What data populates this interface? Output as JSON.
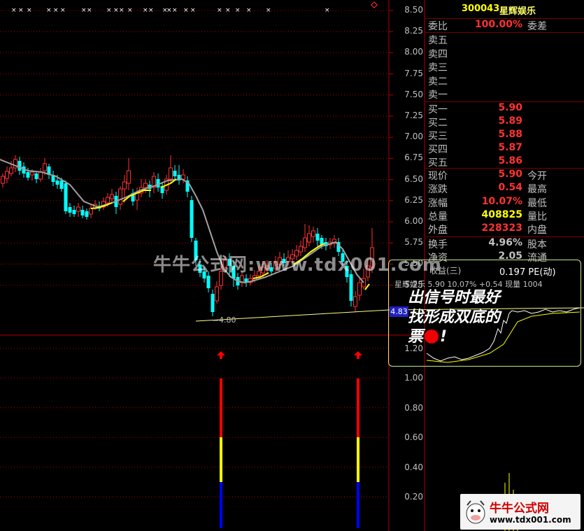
{
  "stock": {
    "code": "300043",
    "name": "星辉娱乐"
  },
  "order_book": {
    "ratio_label": "委比",
    "ratio_value": "100.00%",
    "diff_label": "委差",
    "sell": [
      {
        "label": "卖五",
        "price": ""
      },
      {
        "label": "卖四",
        "price": ""
      },
      {
        "label": "卖三",
        "price": ""
      },
      {
        "label": "卖二",
        "price": ""
      },
      {
        "label": "卖一",
        "price": ""
      }
    ],
    "buy": [
      {
        "label": "买一",
        "price": "5.90"
      },
      {
        "label": "买二",
        "price": "5.89"
      },
      {
        "label": "买三",
        "price": "5.88"
      },
      {
        "label": "买四",
        "price": "5.87"
      },
      {
        "label": "买五",
        "price": "5.86"
      }
    ]
  },
  "quote": {
    "rows": [
      {
        "label": "现价",
        "value": "5.90",
        "label2": "今开",
        "color": "#ff3232"
      },
      {
        "label": "涨跌",
        "value": "0.54",
        "label2": "最高",
        "color": "#ff3232"
      },
      {
        "label": "涨幅",
        "value": "10.07%",
        "label2": "最低",
        "color": "#ff3232"
      },
      {
        "label": "总量",
        "value": "408825",
        "label2": "量比",
        "color": "#ffff00"
      },
      {
        "label": "外盘",
        "value": "228323",
        "label2": "内盘",
        "color": "#ff3232"
      }
    ],
    "rows2": [
      {
        "label": "换手",
        "value": "4.96%",
        "label2": "股本",
        "color": "#c0c0c0"
      },
      {
        "label": "净资",
        "value": "2.05",
        "label2": "流通",
        "color": "#c0c0c0"
      }
    ]
  },
  "inset": {
    "pe_label": "收益(三)",
    "pe_value": "0.197 PE(动)",
    "mini_line": "星辉娱乐  5.90  10.07%  +0.54  现量 1004"
  },
  "price_axis": [
    "8.50",
    "8.25",
    "8.00",
    "7.75",
    "7.50",
    "7.25",
    "7.00",
    "6.75",
    "6.50",
    "6.25",
    "6.00",
    "5.75",
    "5.50",
    "5.25"
  ],
  "indicator_axis": [
    "1.20",
    "1.00",
    "0.80",
    "0.60",
    "0.40",
    "0.20"
  ],
  "current_price_badge": "4.83",
  "low_label": "4.80",
  "annotation": {
    "line1": "出信号时最好",
    "line2": "找形成双底的",
    "line3": "票",
    "line3_end": "!"
  },
  "watermark": "牛牛公式网:www.tdx001.com",
  "logo": {
    "cn": "牛牛公式网",
    "url": "www.tdx001.com"
  },
  "colors": {
    "up": "#ff3232",
    "down": "#00ffff",
    "ma_yellow": "#ffff00",
    "ma_gray": "#a0a0a0",
    "grid_red": "#b00000",
    "signal_red": "#ff0000",
    "signal_yellow": "#ffff00",
    "signal_blue": "#0000ff"
  }
}
